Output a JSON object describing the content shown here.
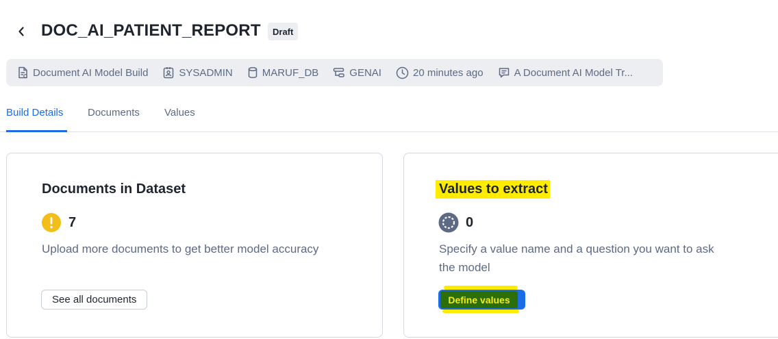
{
  "header": {
    "title": "DOC_AI_PATIENT_REPORT",
    "status_badge": "Draft"
  },
  "meta": [
    {
      "icon": "document-build-icon",
      "text": "Document AI Model Build"
    },
    {
      "icon": "user-badge-icon",
      "text": "SYSADMIN"
    },
    {
      "icon": "database-icon",
      "text": "MARUF_DB"
    },
    {
      "icon": "schema-icon",
      "text": "GENAI"
    },
    {
      "icon": "clock-icon",
      "text": "20 minutes ago"
    },
    {
      "icon": "comment-icon",
      "text": "A Document AI Model Tr..."
    }
  ],
  "tabs": [
    {
      "label": "Build Details",
      "active": true
    },
    {
      "label": "Documents",
      "active": false
    },
    {
      "label": "Values",
      "active": false
    }
  ],
  "cards": {
    "documents": {
      "title": "Documents in Dataset",
      "count": "7",
      "description": "Upload more documents to get better model accuracy",
      "button": "See all documents"
    },
    "values": {
      "title": "Values to extract",
      "count": "0",
      "description_line1": "Specify a value name and a question you want to ask",
      "description_line2": "the model",
      "button": "Define values"
    }
  },
  "colors": {
    "accent": "#1a6ce7",
    "warning": "#f3bd1a",
    "highlight": "#ffec00"
  }
}
